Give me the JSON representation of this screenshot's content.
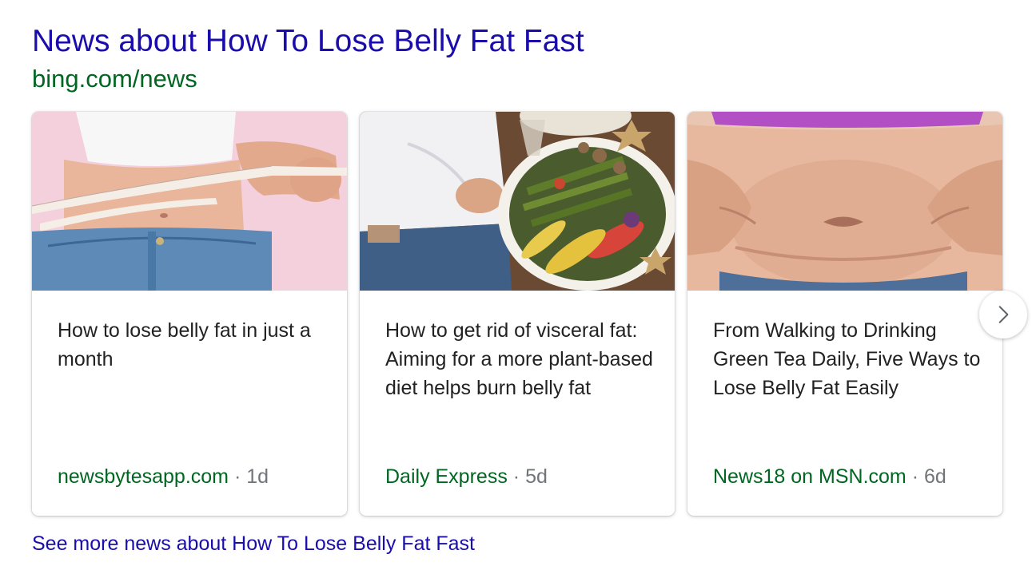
{
  "header": {
    "title": "News about How To Lose Belly Fat Fast",
    "source_url": "bing.com/news"
  },
  "cards": [
    {
      "headline": "How to lose belly fat in just a month",
      "source": "newsbytesapp.com",
      "separator": "·",
      "age": "1d",
      "image": "measuring-tape-waist-image"
    },
    {
      "headline": "How to get rid of visceral fat: Aiming for a more plant-based diet helps burn belly fat",
      "source": "Daily Express",
      "separator": "·",
      "age": "5d",
      "image": "vegetable-platter-image"
    },
    {
      "headline": "From Walking to Drinking Green Tea Daily, Five Ways to Lose Belly Fat Easily",
      "source": "News18 on MSN.com",
      "separator": "·",
      "age": "6d",
      "image": "belly-pinch-image"
    }
  ],
  "carousel": {
    "next_icon": "chevron-right-icon"
  },
  "footer": {
    "see_more": "See more news about How To Lose Belly Fat Fast"
  },
  "colors": {
    "title_link": "#1a0dab",
    "source_green": "#006621",
    "meta_gray": "#70757a",
    "headline_text": "#222222"
  }
}
